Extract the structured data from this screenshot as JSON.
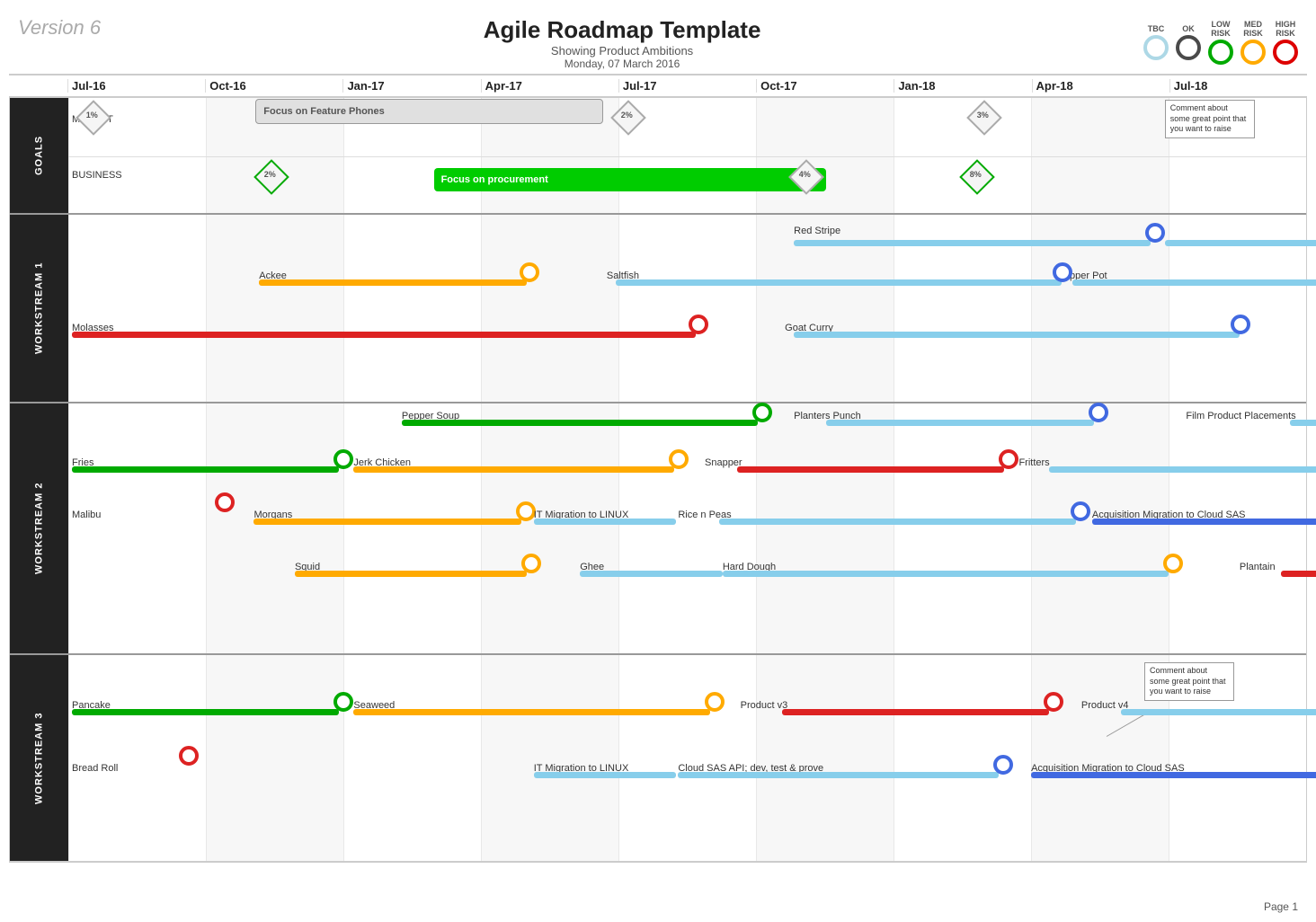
{
  "header": {
    "version": "Version 6",
    "title": "Agile Roadmap Template",
    "subtitle": "Showing Product Ambitions",
    "date": "Monday, 07 March 2016"
  },
  "legend": {
    "items": [
      {
        "label": "TBC",
        "class": "tbc"
      },
      {
        "label": "OK",
        "class": "ok"
      },
      {
        "label": "LOW\nRISK",
        "class": "low"
      },
      {
        "label": "MED\nRISK",
        "class": "med"
      },
      {
        "label": "HIGH\nRISK",
        "class": "high"
      }
    ]
  },
  "months": [
    "Jul-16",
    "Oct-16",
    "Jan-17",
    "Apr-17",
    "Jul-17",
    "Oct-17",
    "Jan-18",
    "Apr-18",
    "Jul-18"
  ],
  "sections": {
    "goals": {
      "label": "GOALS"
    },
    "ws1": {
      "label": "WORKSTREAM 1"
    },
    "ws2": {
      "label": "WORKSTREAM 2"
    },
    "ws3": {
      "label": "WORKSTREAM 3"
    }
  },
  "page": "Page 1"
}
